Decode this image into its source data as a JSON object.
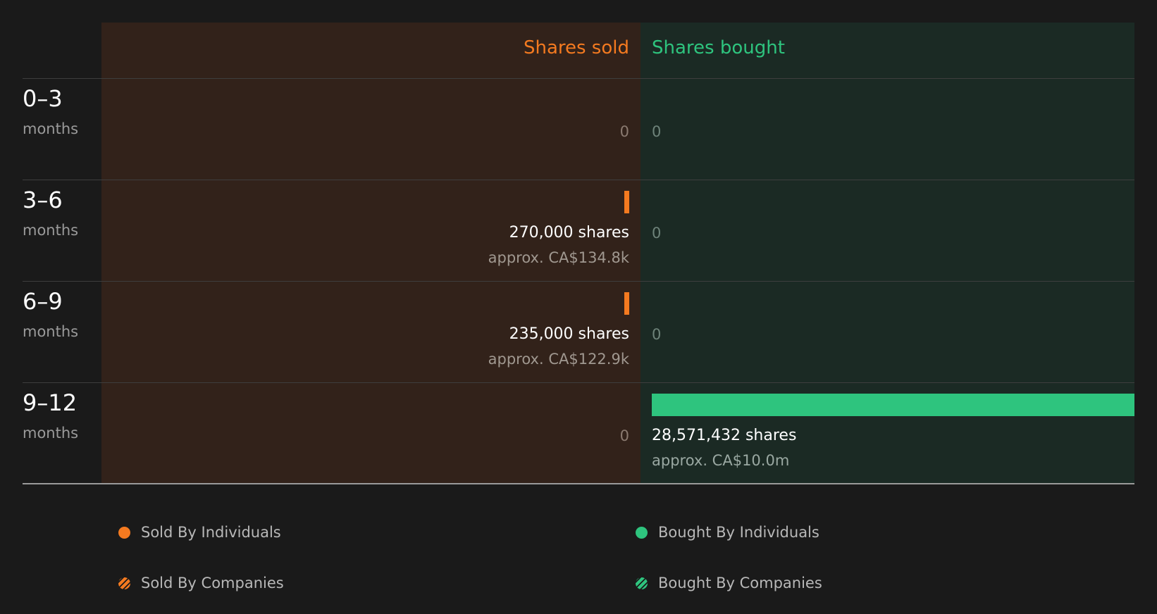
{
  "colors": {
    "sold": "#f47a20",
    "bought": "#2ec47e",
    "background": "#1a1a1a",
    "sold_panel": "#32221a",
    "bought_panel": "#1b2a24"
  },
  "header": {
    "sold_label": "Shares sold",
    "bought_label": "Shares bought"
  },
  "rows": [
    {
      "range": "0–3",
      "unit": "months",
      "sold": {
        "shares": 0,
        "zero_label": "0"
      },
      "bought": {
        "shares": 0,
        "zero_label": "0"
      }
    },
    {
      "range": "3–6",
      "unit": "months",
      "sold": {
        "shares": 270000,
        "shares_label": "270,000 shares",
        "approx_label": "approx. CA$134.8k"
      },
      "bought": {
        "shares": 0,
        "zero_label": "0"
      }
    },
    {
      "range": "6–9",
      "unit": "months",
      "sold": {
        "shares": 235000,
        "shares_label": "235,000 shares",
        "approx_label": "approx. CA$122.9k"
      },
      "bought": {
        "shares": 0,
        "zero_label": "0"
      }
    },
    {
      "range": "9–12",
      "unit": "months",
      "sold": {
        "shares": 0,
        "zero_label": "0"
      },
      "bought": {
        "shares": 28571432,
        "shares_label": "28,571,432 shares",
        "approx_label": "approx. CA$10.0m"
      }
    }
  ],
  "legend": [
    {
      "label": "Sold By Individuals",
      "icon": "solid-dot-icon",
      "color": "#f47a20"
    },
    {
      "label": "Bought By Individuals",
      "icon": "solid-dot-icon",
      "color": "#2ec47e"
    },
    {
      "label": "Sold By Companies",
      "icon": "hatched-dot-icon",
      "color": "#f47a20"
    },
    {
      "label": "Bought By Companies",
      "icon": "hatched-dot-icon",
      "color": "#2ec47e"
    }
  ],
  "chart_data": {
    "type": "bar",
    "categories": [
      "0–3 months",
      "3–6 months",
      "6–9 months",
      "9–12 months"
    ],
    "series": [
      {
        "name": "Shares sold",
        "values": [
          0,
          270000,
          235000,
          0
        ]
      },
      {
        "name": "Shares bought",
        "values": [
          0,
          0,
          0,
          28571432
        ]
      }
    ],
    "value_labels": {
      "sold": [
        "0",
        "approx. CA$134.8k",
        "approx. CA$122.9k",
        "0"
      ],
      "bought": [
        "0",
        "0",
        "0",
        "approx. CA$10.0m"
      ]
    },
    "orientation": "diverging-horizontal",
    "legend_position": "bottom"
  }
}
